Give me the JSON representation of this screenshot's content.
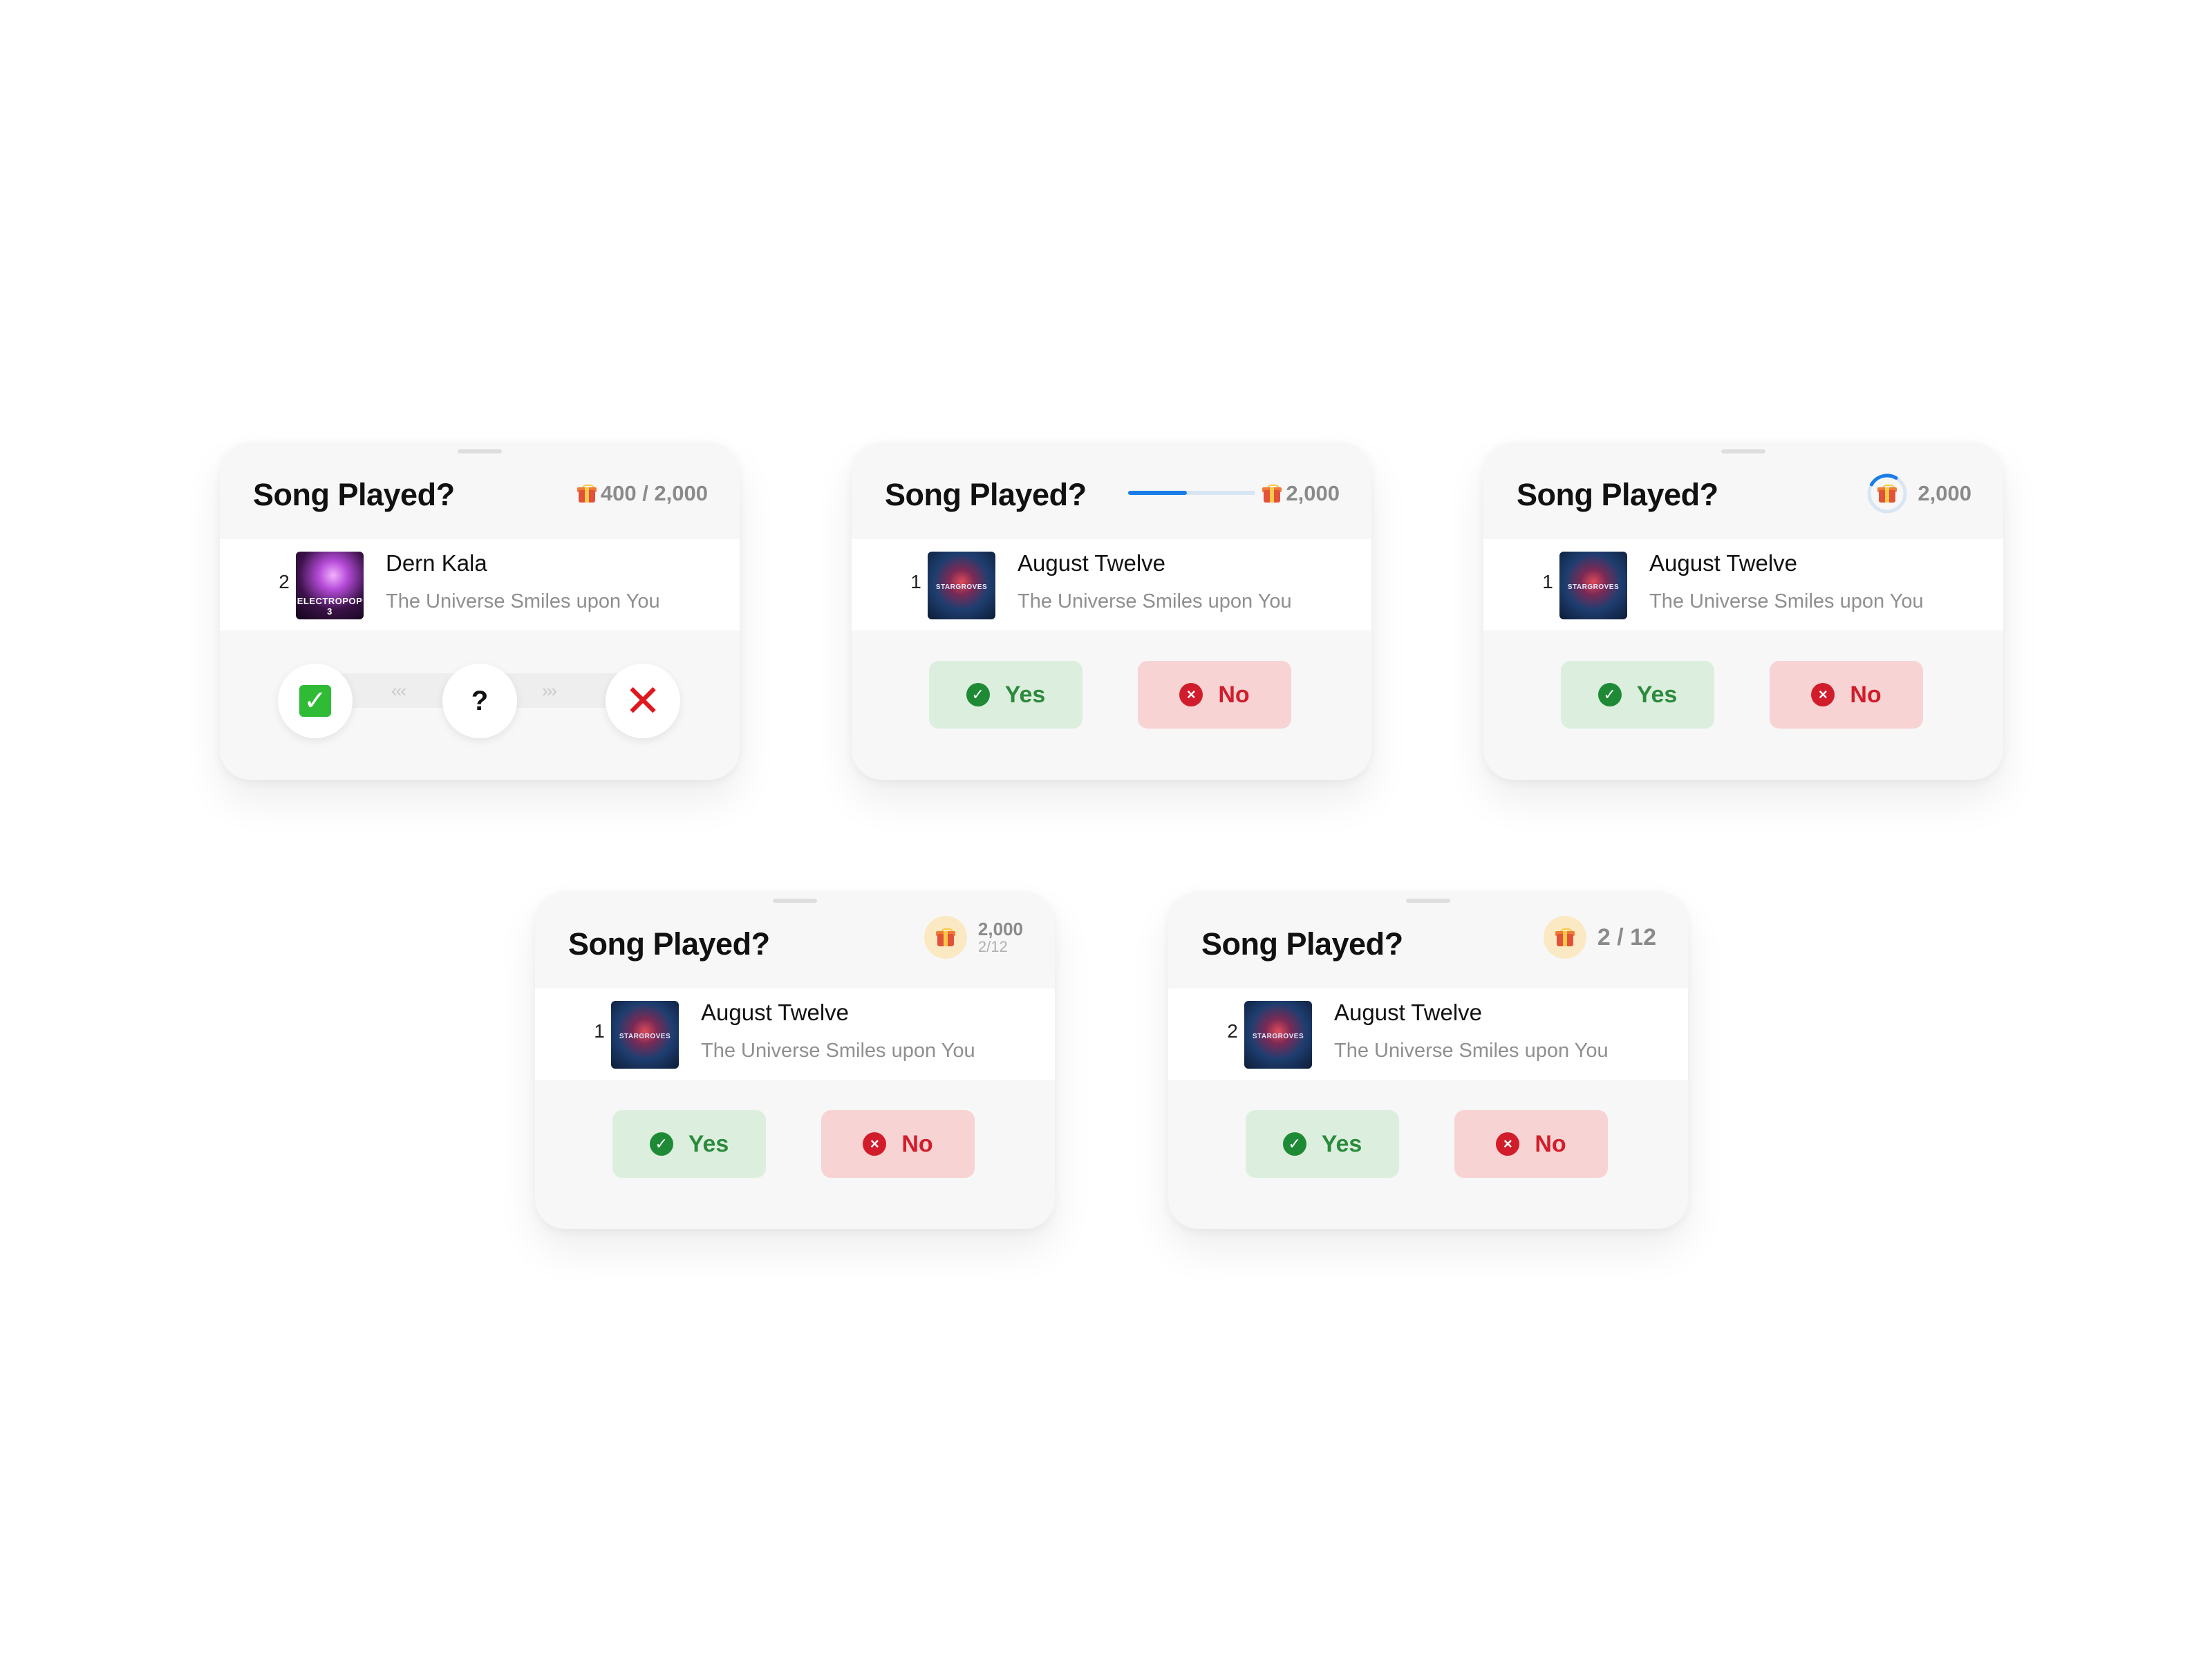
{
  "cards": [
    {
      "title": "Song Played?",
      "reward_text": "400 / 2,000",
      "song_number": "2",
      "artist": "Dern Kala",
      "song_title": "The Universe Smiles upon You",
      "cover_caption": "ELECTROPOP 3",
      "mode": "swipe",
      "center_symbol": "?"
    },
    {
      "title": "Song Played?",
      "reward_text": "2,000",
      "progress_fraction": 0.46,
      "song_number": "1",
      "artist": "August Twelve",
      "song_title": "The Universe Smiles upon You",
      "cover_caption": "STARGROVES",
      "yes_label": "Yes",
      "no_label": "No"
    },
    {
      "title": "Song Played?",
      "reward_text": "2,000",
      "ring_fraction": 0.25,
      "song_number": "1",
      "artist": "August Twelve",
      "song_title": "The Universe Smiles upon You",
      "cover_caption": "STARGROVES",
      "yes_label": "Yes",
      "no_label": "No"
    },
    {
      "title": "Song Played?",
      "reward_top": "2,000",
      "reward_bottom": "2/12",
      "song_number": "1",
      "artist": "August Twelve",
      "song_title": "The Universe Smiles upon You",
      "cover_caption": "STARGROVES",
      "yes_label": "Yes",
      "no_label": "No"
    },
    {
      "title": "Song Played?",
      "reward_text": "2 / 12",
      "song_number": "2",
      "artist": "August Twelve",
      "song_title": "The Universe Smiles upon You",
      "cover_caption": "STARGROVES",
      "yes_label": "Yes",
      "no_label": "No"
    }
  ],
  "colors": {
    "yes_bg": "#dcefde",
    "yes_fg": "#2c8a3c",
    "no_bg": "#f8d3d3",
    "no_fg": "#d11d2b",
    "progress": "#1a7ce8"
  },
  "icons": {
    "reward": "gift-icon",
    "yes": "check-circle-icon",
    "no": "x-circle-icon"
  }
}
